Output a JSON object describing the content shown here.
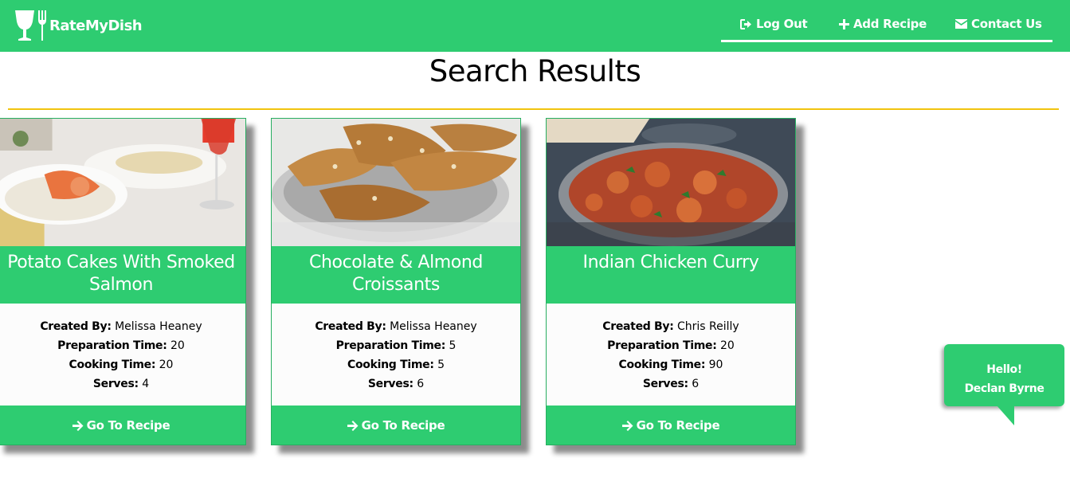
{
  "brand": {
    "name": "RateMyDish"
  },
  "nav": {
    "logout": "Log Out",
    "add_recipe": "Add Recipe",
    "contact": "Contact Us"
  },
  "page": {
    "title": "Search Results"
  },
  "labels": {
    "created_by": "Created By:",
    "prep_time": "Preparation Time:",
    "cooking_time": "Cooking Time:",
    "serves": "Serves:"
  },
  "recipes": [
    {
      "title": "Potato Cakes With Smoked Salmon",
      "created_by": "Melissa Heaney",
      "prep_time": "20",
      "cooking_time": "20",
      "serves": "4",
      "button": "Go To Recipe"
    },
    {
      "title": "Chocolate & Almond Croissants",
      "created_by": "Melissa Heaney",
      "prep_time": "5",
      "cooking_time": "5",
      "serves": "6",
      "button": "Go To Recipe"
    },
    {
      "title": "Indian Chicken Curry",
      "created_by": "Chris Reilly",
      "prep_time": "20",
      "cooking_time": "90",
      "serves": "6",
      "button": "Go To Recipe"
    }
  ],
  "greeting": {
    "line1": "Hello!",
    "line2": "Declan Byrne"
  },
  "colors": {
    "primary_green": "#2ecc71",
    "accent_yellow": "#f1c40f",
    "white": "#ffffff"
  },
  "icons": {
    "logo": "glass-fork-logo-icon",
    "logout": "sign-out-icon",
    "add": "plus-icon",
    "contact": "envelope-icon",
    "go": "arrow-right-icon"
  }
}
